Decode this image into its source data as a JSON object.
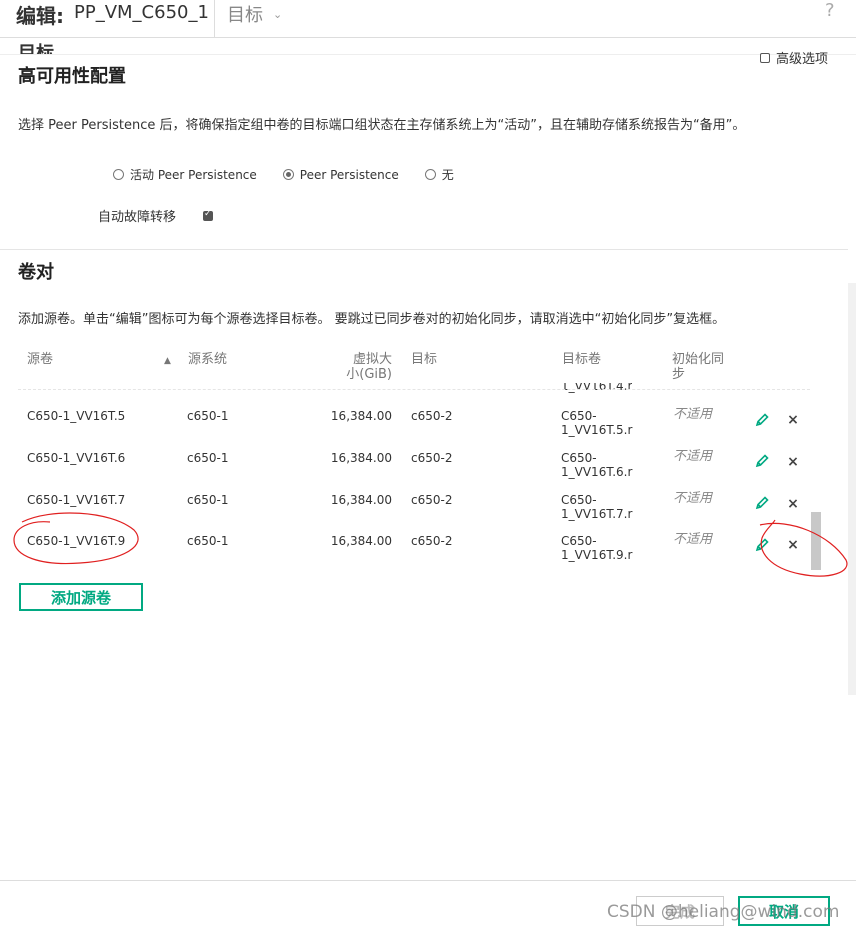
{
  "header": {
    "title_label": "编辑:",
    "title_value": "PP_VM_C650_1",
    "section": "目标",
    "section_chevron": "chevron-down-icon",
    "help": "?"
  },
  "ghost_section_title": "目标",
  "advanced_option": {
    "label": "高级选项",
    "checked": false
  },
  "ha": {
    "title": "高可用性配置",
    "description": "选择 Peer Persistence 后，将确保指定组中卷的目标端口组状态在主存储系统上为“活动”，且在辅助存储系统报告为“备用”。",
    "radios": [
      {
        "label": "活动 Peer Persistence",
        "selected": false
      },
      {
        "label": "Peer Persistence",
        "selected": true
      },
      {
        "label": "无",
        "selected": false
      }
    ],
    "auto_failover": {
      "label": "自动故障转移",
      "checked": true
    }
  },
  "pairs": {
    "title": "卷对",
    "description": "添加源卷。单击“编辑”图标可为每个源卷选择目标卷。 要跳过已同步卷对的初始化同步，请取消选中“初始化同步”复选框。",
    "columns": [
      "源卷",
      "源系统",
      "虚拟大小(GiB)",
      "目标",
      "目标卷",
      "初始化同步"
    ],
    "col_size_l1": "虚拟大",
    "col_size_l2": "小(GiB)",
    "col_init_l1": "初始化同",
    "col_init_l2": "步",
    "partial_row_target_vol": "1_VV16T.4.r",
    "rows": [
      {
        "source_volume": "C650-1_VV16T.5",
        "source_system": "c650-1",
        "size": "16,384.00",
        "target": "c650-2",
        "target_vol_l1": "C650-",
        "target_vol_l2": "1_VV16T.5.r",
        "init_sync": "不适用"
      },
      {
        "source_volume": "C650-1_VV16T.6",
        "source_system": "c650-1",
        "size": "16,384.00",
        "target": "c650-2",
        "target_vol_l1": "C650-",
        "target_vol_l2": "1_VV16T.6.r",
        "init_sync": "不适用"
      },
      {
        "source_volume": "C650-1_VV16T.7",
        "source_system": "c650-1",
        "size": "16,384.00",
        "target": "c650-2",
        "target_vol_l1": "C650-",
        "target_vol_l2": "1_VV16T.7.r",
        "init_sync": "不适用"
      },
      {
        "source_volume": "C650-1_VV16T.9",
        "source_system": "c650-1",
        "size": "16,384.00",
        "target": "c650-2",
        "target_vol_l1": "C650-",
        "target_vol_l2": "1_VV16T.9.r",
        "init_sync": "不适用"
      }
    ],
    "add_button": "添加源卷"
  },
  "footer": {
    "finish_label": "完成",
    "cancel_label": "取消"
  },
  "watermark": "CSDN @heliang@wind.com",
  "colors": {
    "accent": "#01a982",
    "annotation": "#e02020"
  }
}
